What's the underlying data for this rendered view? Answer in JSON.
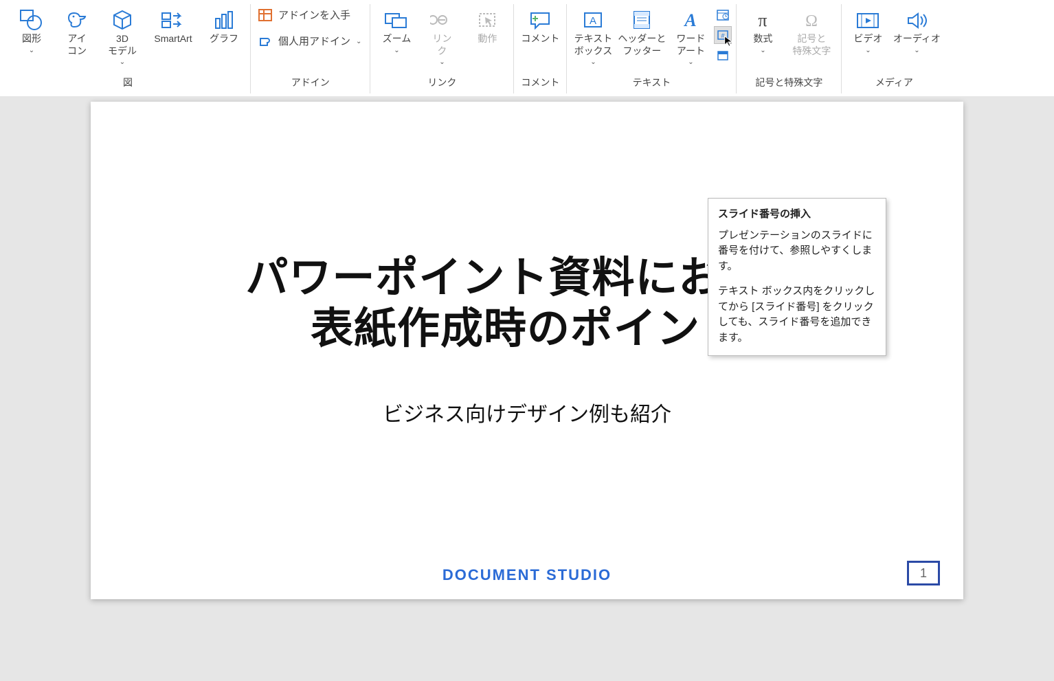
{
  "ribbon": {
    "groups": {
      "illustrations": {
        "label": "図",
        "shapes": "図形",
        "icons": "アイ\nコン",
        "models3d": "3D\nモデル",
        "smartart": "SmartArt",
        "chart": "グラフ"
      },
      "addins": {
        "label": "アドイン",
        "get": "アドインを入手",
        "mine": "個人用アドイン"
      },
      "links": {
        "label": "リンク",
        "zoom": "ズーム",
        "link": "リン\nク",
        "action": "動作"
      },
      "comments": {
        "label": "コメント",
        "comment": "コメント"
      },
      "text": {
        "label": "テキスト",
        "textbox": "テキスト\nボックス",
        "headerfooter": "ヘッダーと\nフッター",
        "wordart": "ワード\nアート"
      },
      "symbols": {
        "label": "記号と特殊文字",
        "equation": "数式",
        "symbol": "記号と\n特殊文字"
      },
      "media": {
        "label": "メディア",
        "video": "ビデオ",
        "audio": "オーディオ"
      }
    }
  },
  "tooltip": {
    "title": "スライド番号の挿入",
    "p1": "プレゼンテーションのスライドに番号を付けて、参照しやすくします。",
    "p2": "テキスト ボックス内をクリックしてから [スライド番号] をクリックしても、スライド番号を追加できます。"
  },
  "slide": {
    "title": "パワーポイント資料における\n表紙作成時のポイント",
    "subtitle": "ビジネス向けデザイン例も紹介",
    "footer": "DOCUMENT STUDIO",
    "page": "1"
  }
}
